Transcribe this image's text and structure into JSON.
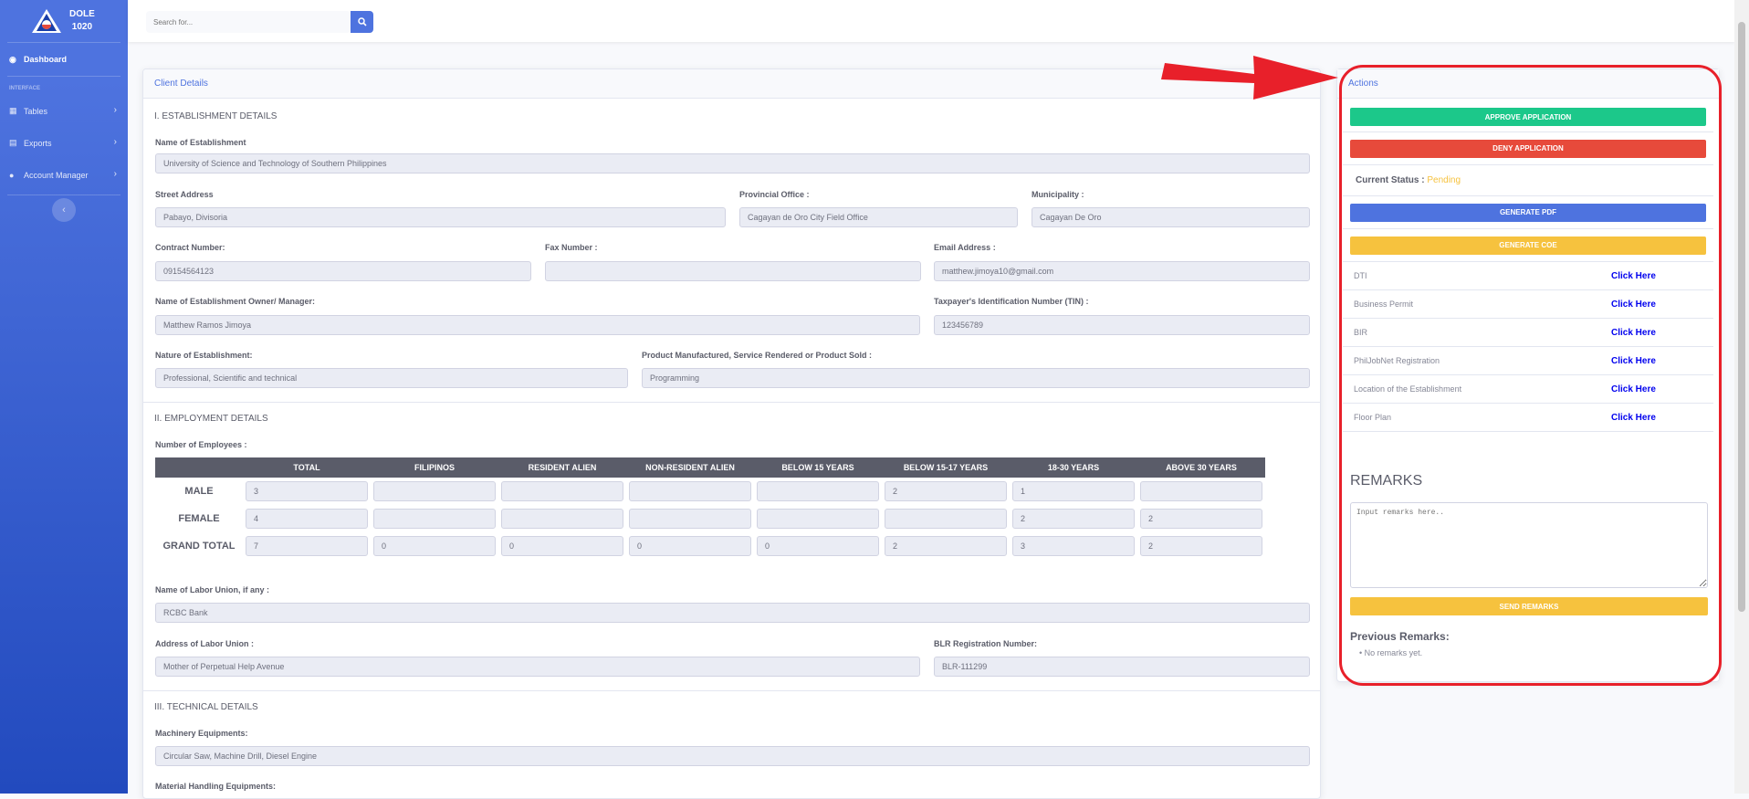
{
  "brand": {
    "line1": "DOLE",
    "line2": "1020"
  },
  "sidebar": {
    "dashboard": "Dashboard",
    "heading": "INTERFACE",
    "items": [
      {
        "label": "Tables"
      },
      {
        "label": "Exports"
      },
      {
        "label": "Account Manager"
      }
    ]
  },
  "search": {
    "placeholder": "Search for..."
  },
  "client": {
    "title": "Client Details",
    "sec1": "I. ESTABLISHMENT DETAILS",
    "name_label": "Name of Establishment",
    "name": "University of Science and Technology of Southern Philippines",
    "street_label": "Street Address",
    "street": "Pabayo, Divisoria",
    "prov_label": "Provincial Office :",
    "prov": "Cagayan de Oro City Field Office",
    "muni_label": "Municipality :",
    "muni": "Cagayan De Oro",
    "contract_label": "Contract Number:",
    "contract": "09154564123",
    "fax_label": "Fax Number :",
    "fax": "",
    "email_label": "Email Address :",
    "email": "matthew.jimoya10@gmail.com",
    "owner_label": "Name of Establishment Owner/ Manager:",
    "owner": "Matthew Ramos Jimoya",
    "tin_label": "Taxpayer's Identification Number (TIN) :",
    "tin": "123456789",
    "nature_label": "Nature of Establishment:",
    "nature": "Professional, Scientific and technical",
    "product_label": "Product Manufactured, Service Rendered or Product Sold :",
    "product": "Programming",
    "sec2": "II. EMPLOYMENT DETAILS",
    "num_emp_label": "Number of Employees :",
    "columns": [
      "TOTAL",
      "FILIPINOS",
      "RESIDENT ALIEN",
      "NON-RESIDENT ALIEN",
      "BELOW 15 YEARS",
      "BELOW 15-17 YEARS",
      "18-30 YEARS",
      "ABOVE 30 YEARS"
    ],
    "rows": [
      {
        "label": "MALE",
        "values": [
          "3",
          "",
          "",
          "",
          "",
          "2",
          "1",
          ""
        ]
      },
      {
        "label": "FEMALE",
        "values": [
          "4",
          "",
          "",
          "",
          "",
          "",
          "2",
          "2"
        ]
      },
      {
        "label": "GRAND TOTAL",
        "values": [
          "7",
          "0",
          "0",
          "0",
          "0",
          "2",
          "3",
          "2"
        ]
      }
    ],
    "union_label": "Name of Labor Union, if any :",
    "union": "RCBC Bank",
    "union_addr_label": "Address of Labor Union :",
    "union_addr": "Mother of Perpetual Help Avenue",
    "blr_label": "BLR Registration Number:",
    "blr": "BLR-111299",
    "sec3": "III. TECHNICAL DETAILS",
    "machinery_label": "Machinery Equipments:",
    "machinery": "Circular Saw, Machine Drill, Diesel Engine",
    "material_label": "Material Handling Equipments:"
  },
  "actions": {
    "title": "Actions",
    "approve": "APPROVE APPLICATION",
    "deny": "DENY APPLICATION",
    "status_label": "Current Status :",
    "status": "Pending",
    "pdf": "GENERATE PDF",
    "coe": "GENERATE COE",
    "docs": [
      {
        "label": "DTI",
        "link": "Click Here"
      },
      {
        "label": "Business Permit",
        "link": "Click Here"
      },
      {
        "label": "BIR",
        "link": "Click Here"
      },
      {
        "label": "PhilJobNet Registration",
        "link": "Click Here"
      },
      {
        "label": "Location of the Establishment",
        "link": "Click Here"
      },
      {
        "label": "Floor Plan",
        "link": "Click Here"
      }
    ],
    "remarks_title": "REMARKS",
    "remarks_placeholder": "Input remarks here..",
    "send": "SEND REMARKS",
    "prev_title": "Previous Remarks:",
    "prev_none": "No remarks yet."
  },
  "colors": {
    "primary": "#4e73df",
    "success": "#1cc88a",
    "danger": "#e74a3b",
    "warning": "#f6c23e",
    "annotation": "#e8202a"
  }
}
